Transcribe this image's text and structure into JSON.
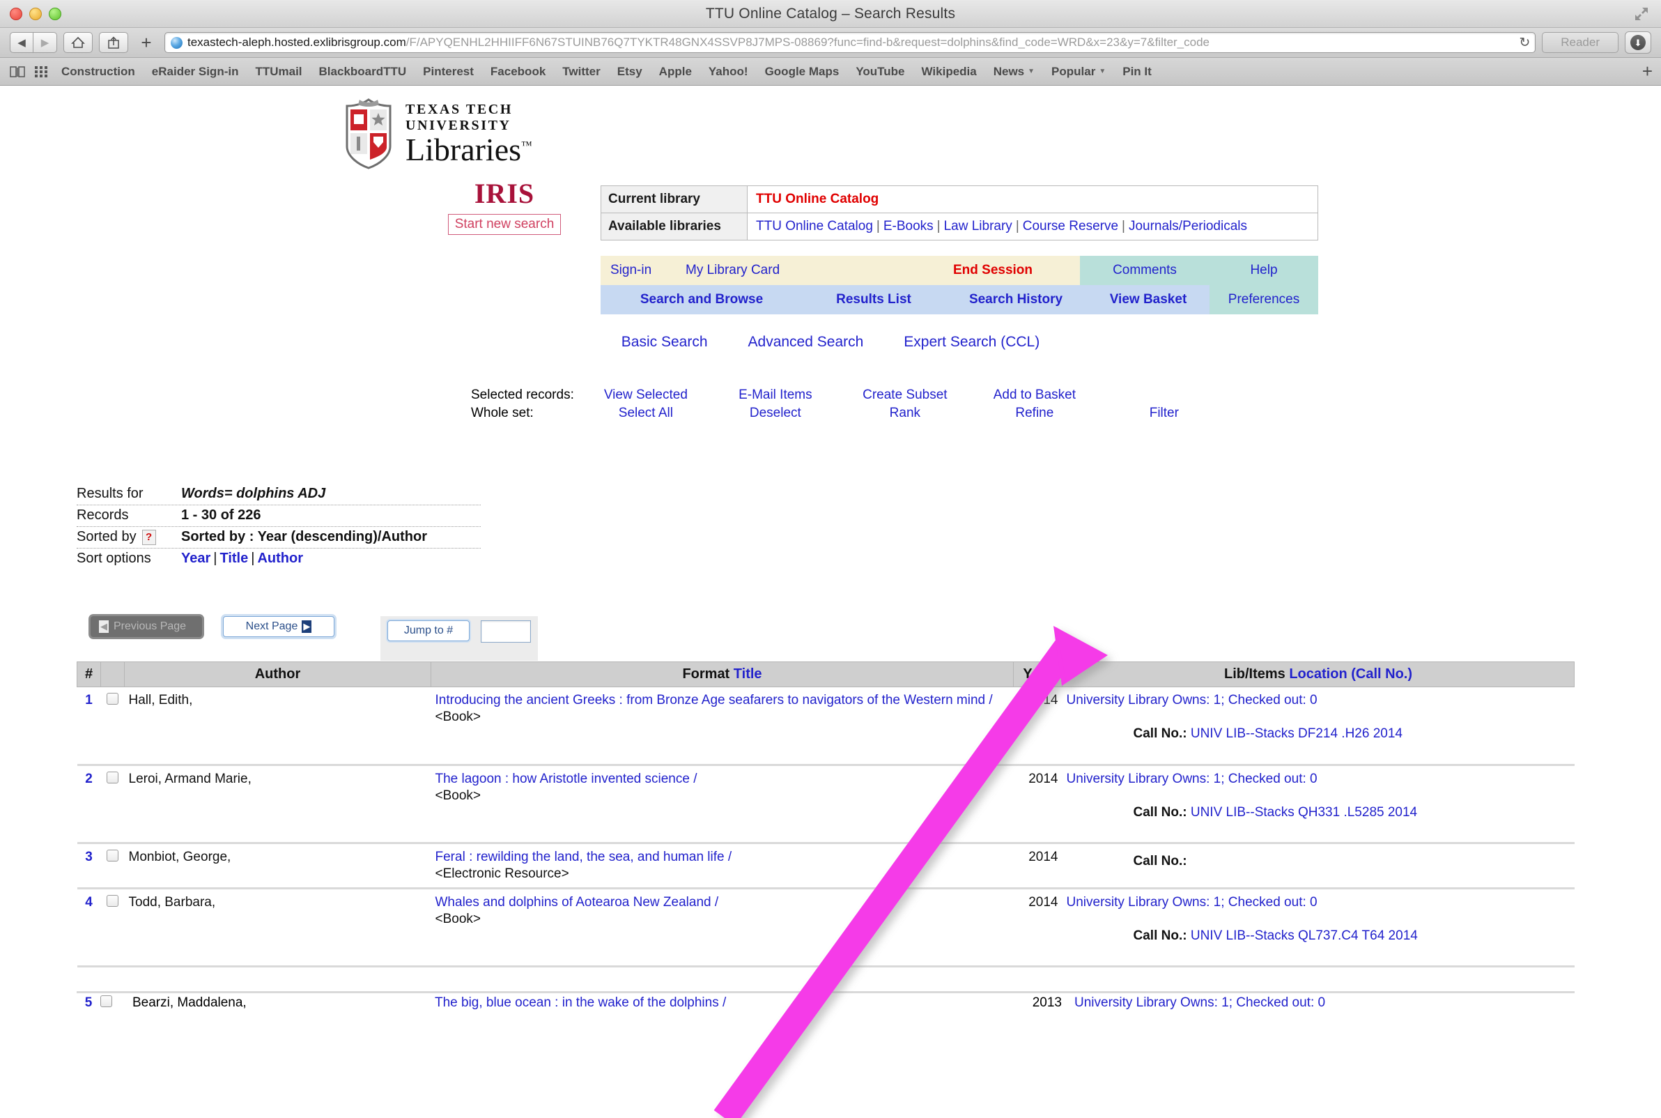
{
  "browser": {
    "window_title": "TTU Online Catalog – Search Results",
    "url_host": "texastech-aleph.hosted.exlibrisgroup.com",
    "url_path": "/F/APYQENHL2HHIIFF6N67STUINB76Q7TYKTR48GNX4SSVP8J7MPS-08869?func=find-b&request=dolphins&find_code=WRD&x=23&y=7&filter_code",
    "reload_glyph": "↻",
    "reader_label": "Reader",
    "download_glyph": "⬇",
    "back_glyph": "◀",
    "forward_glyph": "▶",
    "home_glyph": "⌂",
    "share_glyph": "↥",
    "plus_glyph": "+",
    "fullscreen_glyph": "⤢",
    "bookmarks": [
      {
        "label": "Construction",
        "caret": false
      },
      {
        "label": "eRaider Sign-in",
        "caret": false
      },
      {
        "label": "TTUmail",
        "caret": false
      },
      {
        "label": "BlackboardTTU",
        "caret": false
      },
      {
        "label": "Pinterest",
        "caret": false
      },
      {
        "label": "Facebook",
        "caret": false
      },
      {
        "label": "Twitter",
        "caret": false
      },
      {
        "label": "Etsy",
        "caret": false
      },
      {
        "label": "Apple",
        "caret": false
      },
      {
        "label": "Yahoo!",
        "caret": false
      },
      {
        "label": "Google Maps",
        "caret": false
      },
      {
        "label": "YouTube",
        "caret": false
      },
      {
        "label": "Wikipedia",
        "caret": false
      },
      {
        "label": "News",
        "caret": true
      },
      {
        "label": "Popular",
        "caret": true
      },
      {
        "label": "Pin It",
        "caret": false
      }
    ],
    "bookmark_plus": "+"
  },
  "branding": {
    "university_line": "TEXAS TECH UNIVERSITY",
    "libraries_line": "Libraries",
    "trademark": "™",
    "system_name": "IRIS",
    "start_new_search": "Start new search"
  },
  "library_box": {
    "current_label": "Current library",
    "current_value": "TTU Online Catalog",
    "available_label": "Available libraries",
    "available": [
      "TTU Online Catalog",
      "E-Books",
      "Law Library",
      "Course Reserve",
      "Journals/Periodicals"
    ],
    "separator": "|"
  },
  "nav": {
    "row1": [
      {
        "label": "Sign-in",
        "style": "cream-left"
      },
      {
        "label": "My Library Card",
        "style": "cream-left"
      },
      {
        "label": "End Session",
        "style": "cream-red"
      },
      {
        "label": "Comments",
        "style": "teal"
      },
      {
        "label": "Help",
        "style": "teal"
      }
    ],
    "row2": [
      {
        "label": "Search and Browse",
        "style": "blue"
      },
      {
        "label": "Results List",
        "style": "blue"
      },
      {
        "label": "Search History",
        "style": "blue"
      },
      {
        "label": "View Basket",
        "style": "blue"
      },
      {
        "label": "Preferences",
        "style": "teal"
      }
    ]
  },
  "search_modes": [
    "Basic Search",
    "Advanced Search",
    "Expert Search (CCL)"
  ],
  "actions": {
    "selected_label": "Selected records:",
    "wholeset_label": "Whole set:",
    "selected_row": [
      "View Selected",
      "E-Mail Items",
      "Create Subset",
      "Add to Basket",
      ""
    ],
    "wholeset_row": [
      "Select All",
      "Deselect",
      "Rank",
      "Refine",
      "Filter"
    ]
  },
  "summary": {
    "results_for_label": "Results for",
    "results_for_value": "Words= dolphins ADJ",
    "records_label": "Records",
    "records_value": "1 - 30 of 226",
    "sorted_by_label": "Sorted by",
    "sorted_by_help": "?",
    "sorted_by_value": "Sorted by : Year (descending)/Author",
    "sort_options_label": "Sort options",
    "sort_options": [
      "Year",
      "Title",
      "Author"
    ],
    "pipe": "|"
  },
  "pager": {
    "previous_label": "Previous Page",
    "next_label": "Next Page",
    "jump_label": "Jump to #",
    "jump_value": "",
    "prev_glyph": "◀",
    "next_glyph": "▶"
  },
  "table": {
    "headers": {
      "num": "#",
      "checkbox": "",
      "author": "Author",
      "format": "Format",
      "title": "Title",
      "year": "Year",
      "libitems": "Lib/Items",
      "location": "Location (Call No.)"
    },
    "call_no_label": "Call No.:",
    "rows": [
      {
        "num": "1",
        "author": "Hall, Edith,",
        "title": "Introducing the ancient Greeks : from Bronze Age seafarers to navigators of the Western mind /",
        "format": "<Book>",
        "year": "2014",
        "holdings": "University Library Owns: 1; Checked out: 0",
        "call_no": "UNIV LIB--Stacks DF214 .H26 2014"
      },
      {
        "num": "2",
        "author": "Leroi, Armand Marie,",
        "title": "The lagoon : how Aristotle invented science /",
        "format": "<Book>",
        "year": "2014",
        "holdings": "University Library Owns: 1; Checked out: 0",
        "call_no": "UNIV LIB--Stacks QH331 .L5285 2014"
      },
      {
        "num": "3",
        "author": "Monbiot, George,",
        "title": "Feral : rewilding the land, the sea, and human life /",
        "format": "<Electronic Resource>",
        "year": "2014",
        "holdings": "",
        "call_no": ""
      },
      {
        "num": "4",
        "author": "Todd, Barbara,",
        "title": "Whales and dolphins of Aotearoa New Zealand /",
        "format": "<Book>",
        "year": "2014",
        "holdings": "University Library Owns: 1; Checked out: 0",
        "call_no": "UNIV LIB--Stacks QL737.C4 T64 2014"
      }
    ],
    "partial_row": {
      "num": "5",
      "author": "Bearzi, Maddalena,",
      "title": "The big, blue ocean : in the wake of the dolphins /",
      "year": "2013",
      "holdings": "University Library Owns: 1; Checked out: 0"
    }
  },
  "annotation": {
    "arrow_color": "#f53ae8",
    "arrow_name": "pink-pointer-arrow"
  }
}
